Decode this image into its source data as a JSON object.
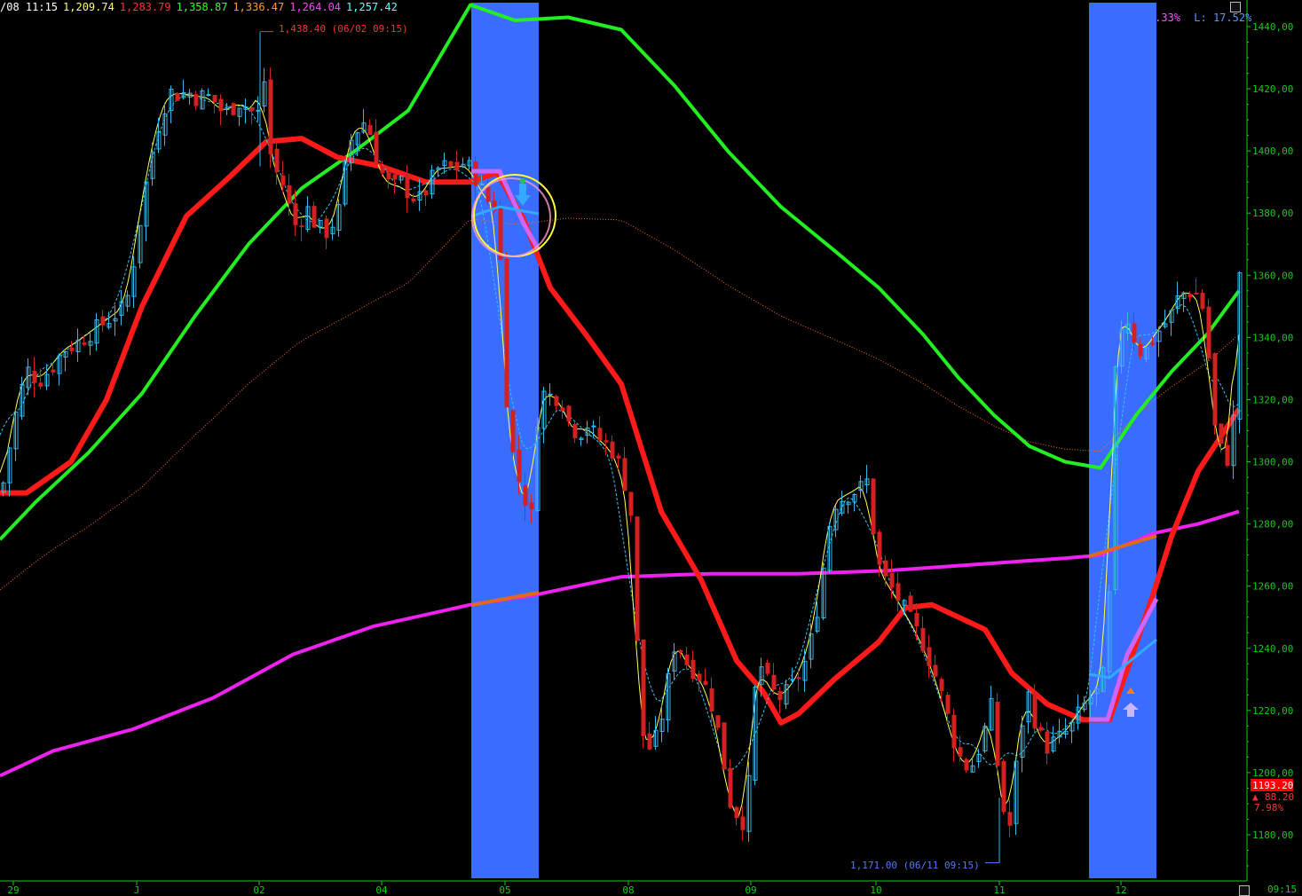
{
  "header": {
    "items": [
      {
        "text": "/08 11:15",
        "color": "#ffffff"
      },
      {
        "text": "1,209.74",
        "color": "#ffff66"
      },
      {
        "text": "1,283.79",
        "color": "#ff3333"
      },
      {
        "text": "1,358.87",
        "color": "#33ff33"
      },
      {
        "text": "1,336.47",
        "color": "#ff9933"
      },
      {
        "text": "1,264.04",
        "color": "#ff44ff"
      },
      {
        "text": "1,257.42",
        "color": "#66ffff"
      }
    ]
  },
  "hl_box": {
    "h_label": "H: -4.33%",
    "l_label": "L: 17.52%"
  },
  "annotations": {
    "high_label": "1,438.40 (06/02 09:15)",
    "low_label": "1,171.00 (06/11 09:15)"
  },
  "last_price": {
    "value": "1193.20",
    "change": "88.20",
    "pct": "7.98%"
  },
  "time_label": "09:15",
  "colors": {
    "background": "#000000",
    "axis": "#19c819",
    "up_candle": "#35b8e6",
    "down_candle": "#d32020",
    "ma_fast_yellow": "#ffff55",
    "ma_dashed_cyan": "#33c4ee",
    "ma_red": "#ff1a1a",
    "ma_green": "#22ee22",
    "ma_magenta": "#ee22ee",
    "ma_dotted_orange": "#ff6a1a",
    "highlight": "#3a6cff"
  },
  "chart_data": {
    "type": "candlestick",
    "ylim": [
      1165,
      1450
    ],
    "y_ticks": [
      "1440,00",
      "1420,00",
      "1400,00",
      "1380,00",
      "1360,00",
      "1340,00",
      "1320,00",
      "1300,00",
      "1280,00",
      "1260,00",
      "1240,00",
      "1220,00",
      "1200,00",
      "1180,00"
    ],
    "x_ticks": [
      "29",
      "J",
      "02",
      "04",
      "05",
      "08",
      "09",
      "10",
      "11",
      "12"
    ],
    "x_tick_positions": [
      15,
      154,
      292,
      430,
      569,
      708,
      846,
      987,
      1126,
      1263
    ],
    "price_points": [
      [
        0,
        1290
      ],
      [
        14,
        1313
      ],
      [
        28,
        1330
      ],
      [
        42,
        1326
      ],
      [
        56,
        1330
      ],
      [
        70,
        1336
      ],
      [
        84,
        1338
      ],
      [
        98,
        1341
      ],
      [
        112,
        1344
      ],
      [
        126,
        1347
      ],
      [
        140,
        1350
      ],
      [
        150,
        1366
      ],
      [
        160,
        1385
      ],
      [
        170,
        1400
      ],
      [
        180,
        1412
      ],
      [
        190,
        1419
      ],
      [
        200,
        1418
      ],
      [
        210,
        1419
      ],
      [
        220,
        1417
      ],
      [
        230,
        1418
      ],
      [
        240,
        1416
      ],
      [
        250,
        1412
      ],
      [
        260,
        1414
      ],
      [
        270,
        1416
      ],
      [
        280,
        1413
      ],
      [
        290,
        1412
      ],
      [
        294,
        1430
      ],
      [
        302,
        1400
      ],
      [
        310,
        1393
      ],
      [
        318,
        1389
      ],
      [
        326,
        1380
      ],
      [
        334,
        1374
      ],
      [
        342,
        1383
      ],
      [
        350,
        1378
      ],
      [
        358,
        1375
      ],
      [
        366,
        1374
      ],
      [
        374,
        1377
      ],
      [
        382,
        1382
      ],
      [
        390,
        1402
      ],
      [
        398,
        1405
      ],
      [
        406,
        1410
      ],
      [
        414,
        1407
      ],
      [
        422,
        1398
      ],
      [
        430,
        1392
      ],
      [
        440,
        1388
      ],
      [
        450,
        1390
      ],
      [
        460,
        1386
      ],
      [
        470,
        1384
      ],
      [
        480,
        1388
      ],
      [
        490,
        1394
      ],
      [
        500,
        1395
      ],
      [
        510,
        1394
      ],
      [
        520,
        1396
      ],
      [
        530,
        1394
      ],
      [
        540,
        1388
      ],
      [
        550,
        1383
      ],
      [
        560,
        1382
      ],
      [
        566,
        1330
      ],
      [
        574,
        1305
      ],
      [
        582,
        1295
      ],
      [
        590,
        1288
      ],
      [
        598,
        1282
      ],
      [
        604,
        1314
      ],
      [
        610,
        1322
      ],
      [
        620,
        1321
      ],
      [
        630,
        1321
      ],
      [
        640,
        1312
      ],
      [
        650,
        1309
      ],
      [
        660,
        1312
      ],
      [
        670,
        1308
      ],
      [
        680,
        1306
      ],
      [
        690,
        1303
      ],
      [
        700,
        1296
      ],
      [
        710,
        1282
      ],
      [
        720,
        1214
      ],
      [
        730,
        1208
      ],
      [
        740,
        1212
      ],
      [
        750,
        1228
      ],
      [
        760,
        1244
      ],
      [
        770,
        1236
      ],
      [
        780,
        1233
      ],
      [
        790,
        1230
      ],
      [
        800,
        1222
      ],
      [
        810,
        1210
      ],
      [
        820,
        1191
      ],
      [
        830,
        1186
      ],
      [
        840,
        1183
      ],
      [
        846,
        1223
      ],
      [
        856,
        1234
      ],
      [
        866,
        1227
      ],
      [
        876,
        1224
      ],
      [
        886,
        1226
      ],
      [
        896,
        1230
      ],
      [
        906,
        1236
      ],
      [
        916,
        1247
      ],
      [
        926,
        1266
      ],
      [
        936,
        1286
      ],
      [
        946,
        1288
      ],
      [
        956,
        1290
      ],
      [
        966,
        1291
      ],
      [
        976,
        1294
      ],
      [
        986,
        1268
      ],
      [
        996,
        1262
      ],
      [
        1006,
        1258
      ],
      [
        1016,
        1253
      ],
      [
        1026,
        1248
      ],
      [
        1036,
        1243
      ],
      [
        1046,
        1236
      ],
      [
        1056,
        1228
      ],
      [
        1066,
        1218
      ],
      [
        1076,
        1207
      ],
      [
        1086,
        1202
      ],
      [
        1096,
        1203
      ],
      [
        1106,
        1212
      ],
      [
        1116,
        1222
      ],
      [
        1126,
        1190
      ],
      [
        1136,
        1183
      ],
      [
        1146,
        1210
      ],
      [
        1156,
        1226
      ],
      [
        1166,
        1215
      ],
      [
        1176,
        1208
      ],
      [
        1186,
        1210
      ],
      [
        1196,
        1212
      ],
      [
        1206,
        1215
      ],
      [
        1216,
        1220
      ],
      [
        1226,
        1224
      ],
      [
        1236,
        1226
      ],
      [
        1246,
        1236
      ],
      [
        1256,
        1338
      ],
      [
        1266,
        1348
      ],
      [
        1276,
        1340
      ],
      [
        1286,
        1334
      ],
      [
        1296,
        1339
      ],
      [
        1306,
        1343
      ],
      [
        1316,
        1346
      ],
      [
        1326,
        1353
      ],
      [
        1336,
        1355
      ],
      [
        1346,
        1354
      ],
      [
        1356,
        1348
      ],
      [
        1366,
        1312
      ],
      [
        1376,
        1302
      ],
      [
        1386,
        1300
      ],
      [
        1396,
        1368
      ]
    ],
    "ma_red_points": [
      [
        0,
        1290
      ],
      [
        30,
        1290
      ],
      [
        80,
        1300
      ],
      [
        120,
        1320
      ],
      [
        160,
        1350
      ],
      [
        210,
        1379
      ],
      [
        260,
        1392
      ],
      [
        300,
        1403
      ],
      [
        340,
        1404
      ],
      [
        380,
        1398
      ],
      [
        430,
        1395
      ],
      [
        480,
        1390
      ],
      [
        530,
        1390
      ],
      [
        560,
        1393
      ],
      [
        590,
        1378
      ],
      [
        620,
        1356
      ],
      [
        660,
        1341
      ],
      [
        700,
        1325
      ],
      [
        745,
        1284
      ],
      [
        790,
        1262
      ],
      [
        830,
        1236
      ],
      [
        860,
        1226
      ],
      [
        880,
        1216
      ],
      [
        900,
        1219
      ],
      [
        940,
        1230
      ],
      [
        990,
        1242
      ],
      [
        1020,
        1253
      ],
      [
        1050,
        1254
      ],
      [
        1080,
        1250
      ],
      [
        1110,
        1246
      ],
      [
        1140,
        1232
      ],
      [
        1180,
        1222
      ],
      [
        1220,
        1217
      ],
      [
        1250,
        1217
      ],
      [
        1270,
        1233
      ],
      [
        1300,
        1258
      ],
      [
        1320,
        1276
      ],
      [
        1350,
        1297
      ],
      [
        1396,
        1317
      ]
    ],
    "ma_green_points": [
      [
        0,
        1275
      ],
      [
        40,
        1287
      ],
      [
        100,
        1303
      ],
      [
        160,
        1322
      ],
      [
        220,
        1347
      ],
      [
        280,
        1370
      ],
      [
        340,
        1388
      ],
      [
        400,
        1400
      ],
      [
        460,
        1413
      ],
      [
        530,
        1447
      ],
      [
        580,
        1442
      ],
      [
        640,
        1443
      ],
      [
        700,
        1439
      ],
      [
        760,
        1421
      ],
      [
        820,
        1400
      ],
      [
        880,
        1382
      ],
      [
        940,
        1368
      ],
      [
        990,
        1356
      ],
      [
        1040,
        1341
      ],
      [
        1080,
        1327
      ],
      [
        1120,
        1315
      ],
      [
        1160,
        1305
      ],
      [
        1200,
        1300
      ],
      [
        1240,
        1298
      ],
      [
        1280,
        1315
      ],
      [
        1320,
        1329
      ],
      [
        1360,
        1341
      ],
      [
        1396,
        1355
      ]
    ],
    "ma_magenta_points": [
      [
        0,
        1199
      ],
      [
        60,
        1207
      ],
      [
        150,
        1214
      ],
      [
        240,
        1224
      ],
      [
        330,
        1238
      ],
      [
        420,
        1247
      ],
      [
        530,
        1254
      ],
      [
        600,
        1257
      ],
      [
        700,
        1263
      ],
      [
        800,
        1264
      ],
      [
        900,
        1264
      ],
      [
        1000,
        1265
      ],
      [
        1100,
        1267
      ],
      [
        1200,
        1269
      ],
      [
        1240,
        1270
      ],
      [
        1300,
        1277
      ],
      [
        1350,
        1280
      ],
      [
        1396,
        1284
      ]
    ],
    "highlights": [
      [
        531,
        607
      ],
      [
        1227,
        1303
      ]
    ]
  }
}
